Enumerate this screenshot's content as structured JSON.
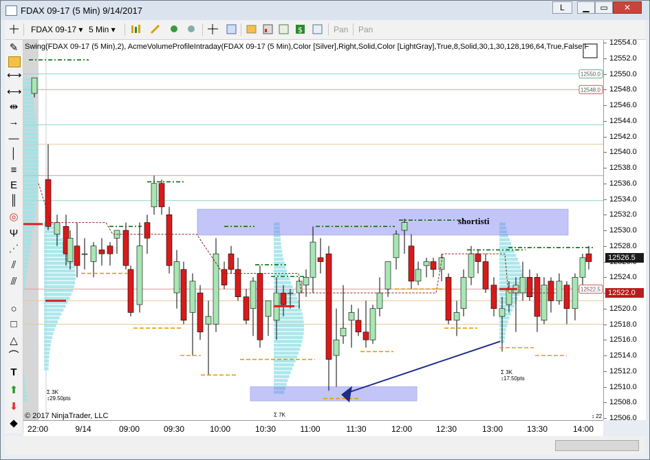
{
  "window": {
    "title": "FDAX 09-17 (5 Min)  9/14/2017",
    "btn_l": "L",
    "btn_minimize": "▭",
    "btn_maximize": "□",
    "btn_close": "✕"
  },
  "toolbar": {
    "instrument": "FDAX 09-17",
    "interval": "5 Min",
    "pan1": "Pan",
    "pan2": "Pan"
  },
  "chart": {
    "indicator_label": "Swing(FDAX 09-17 (5 Min),2), AcmeVolumeProfileIntraday(FDAX 09-17 (5 Min),Color [Silver],Right,Solid,Color [LightGray],True,8,Solid,30,1,30,128,196,64,True,False,F",
    "annotation": "shortisti",
    "copyright": "© 2017 NinjaTrader, LLC",
    "vol_labels": [
      "Σ 3K",
      "↕29.50pts",
      "Σ 7K",
      "Σ 3K",
      "↕17.50pts",
      "↕ 22"
    ],
    "flag_labels": [
      "12550.0",
      "12548.0",
      "12522.5"
    ],
    "last_price": "12526.5",
    "current_price": "12522.0",
    "colors": {
      "up": "#a8e6b4",
      "down": "#d91a1a",
      "box": "#7b7ff0",
      "arrow": "#1f2a8a",
      "profile": "#9ee3e8"
    }
  },
  "xaxis_labels": [
    "22:00",
    "9/14",
    "09:00",
    "09:30",
    "10:00",
    "10:30",
    "11:00",
    "11:30",
    "12:00",
    "12:30",
    "13:00",
    "13:30",
    "14:00"
  ],
  "yaxis_labels": [
    "12554.0",
    "12552.0",
    "12550.0",
    "12548.0",
    "12546.0",
    "12544.0",
    "12542.0",
    "12540.0",
    "12538.0",
    "12536.0",
    "12534.0",
    "12532.0",
    "12530.0",
    "12528.0",
    "12526.0",
    "12524.0",
    "12522.0",
    "12520.0",
    "12518.0",
    "12516.0",
    "12514.0",
    "12512.0",
    "12510.0",
    "12508.0",
    "12506.0"
  ]
}
